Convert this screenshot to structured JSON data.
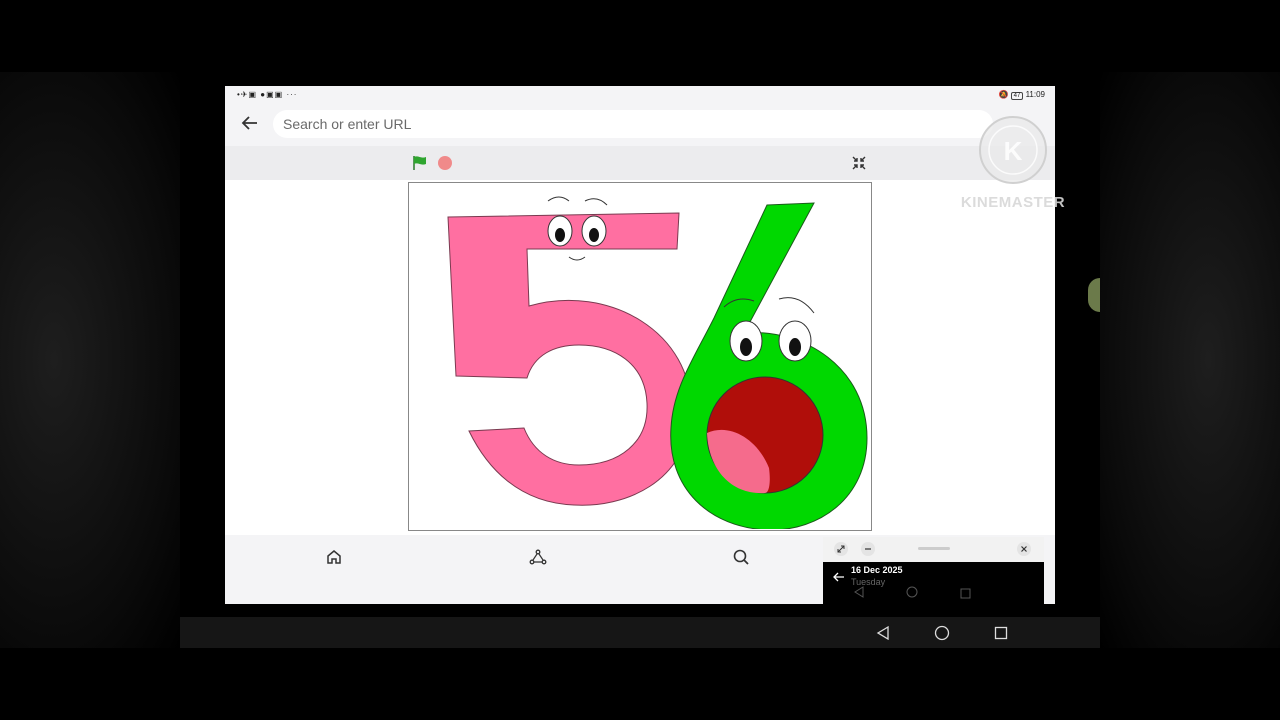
{
  "status_bar": {
    "left_icons": "•✈▣ ●▣▣ ···",
    "time": "11:09",
    "battery": "47"
  },
  "browser": {
    "url_placeholder": "Search or enter URL"
  },
  "pip": {
    "date": "16 Dec 2025",
    "day": "Tuesday"
  },
  "watermark": {
    "text": "KINEMASTER",
    "logo_letter": "K"
  },
  "colors": {
    "five_pink": "#ff6fa1",
    "six_green": "#00d800",
    "mouth_red": "#b00e0a",
    "tongue_pink": "#f56b8c"
  },
  "icons": {
    "back": "arrow-left-icon",
    "green_flag": "green-flag-icon",
    "stop": "stop-icon",
    "fullscreen": "fullscreen-exit-icon",
    "home": "home-icon",
    "share": "share-icon",
    "search": "search-icon"
  }
}
